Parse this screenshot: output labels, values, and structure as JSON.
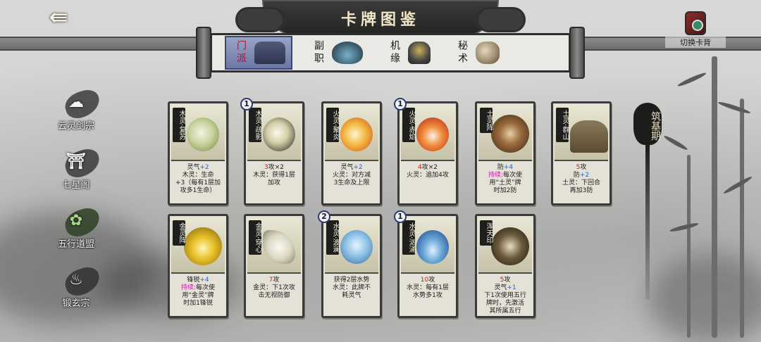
{
  "header": {
    "title": "卡牌图鉴",
    "back_icon": "back-arrow-icon",
    "switch_back_label": "切换卡背"
  },
  "tabs": [
    {
      "label": "门派",
      "icon": "sect-gate-icon",
      "active": true
    },
    {
      "label": "副职",
      "icon": "straw-hat-icon",
      "active": false
    },
    {
      "label": "机缘",
      "icon": "helmet-icon",
      "active": false
    },
    {
      "label": "秘术",
      "icon": "gourd-icon",
      "active": false
    }
  ],
  "sects": [
    {
      "label": "云灵剑宗",
      "icon": "cloud-sword-icon"
    },
    {
      "label": "七星阁",
      "icon": "pavilion-icon"
    },
    {
      "label": "五行道盟",
      "icon": "five-elements-icon"
    },
    {
      "label": "锻玄宗",
      "icon": "forge-icon"
    }
  ],
  "realm": {
    "label": "筑基期"
  },
  "cards": [
    {
      "tag": "木灵·复苏",
      "art": "wood",
      "badge": "",
      "lines": [
        [
          {
            "t": "灵气"
          },
          {
            "t": "+2",
            "c": "blue"
          }
        ],
        [
          {
            "t": "木灵：生命"
          }
        ],
        [
          {
            "t": "+3（每有1层加"
          }
        ],
        [
          {
            "t": "攻多1生命）"
          }
        ]
      ]
    },
    {
      "tag": "木灵·疏影",
      "art": "woodshadow",
      "badge": "1",
      "lines": [
        [
          {
            "t": "3",
            "c": "red"
          },
          {
            "t": "攻×2"
          }
        ],
        [
          {
            "t": "木灵：获得1层"
          }
        ],
        [
          {
            "t": "加攻"
          }
        ]
      ]
    },
    {
      "tag": "火灵·聚炎",
      "art": "fire",
      "badge": "",
      "lines": [
        [
          {
            "t": "灵气"
          },
          {
            "t": "+2",
            "c": "blue"
          }
        ],
        [
          {
            "t": "火灵：对方减"
          }
        ],
        [
          {
            "t": "3生命及上限"
          }
        ]
      ]
    },
    {
      "tag": "火灵·赤焰",
      "art": "fire2",
      "badge": "1",
      "lines": [
        [
          {
            "t": "4",
            "c": "red"
          },
          {
            "t": "攻×2"
          }
        ],
        [
          {
            "t": "火灵：追加4攻"
          }
        ]
      ]
    },
    {
      "tag": "土灵阵",
      "art": "earth",
      "badge": "",
      "lines": [
        [
          {
            "t": "防"
          },
          {
            "t": "+4",
            "c": "blue"
          }
        ],
        [
          {
            "t": "持续:",
            "c": "mag"
          },
          {
            "t": "每次使"
          }
        ],
        [
          {
            "t": "用“土灵”牌"
          }
        ],
        [
          {
            "t": "时加2防"
          }
        ]
      ]
    },
    {
      "tag": "土灵·群山",
      "art": "mountain",
      "badge": "",
      "lines": [
        [
          {
            "t": "5",
            "c": "red"
          },
          {
            "t": "攻"
          }
        ],
        [
          {
            "t": "防"
          },
          {
            "t": "+2",
            "c": "blue"
          }
        ],
        [
          {
            "t": "土灵：下回合"
          }
        ],
        [
          {
            "t": "再加3防"
          }
        ]
      ]
    },
    {
      "tag": "金灵阵",
      "art": "gold",
      "badge": "",
      "lines": [
        [
          {
            "t": "锋锐"
          },
          {
            "t": "+4",
            "c": "blue"
          }
        ],
        [
          {
            "t": "持续:",
            "c": "mag"
          },
          {
            "t": "每次使"
          }
        ],
        [
          {
            "t": "用“金灵”牌"
          }
        ],
        [
          {
            "t": "时加1锋锐"
          }
        ]
      ]
    },
    {
      "tag": "金灵·穿心",
      "art": "metal",
      "badge": "",
      "lines": [
        [
          {
            "t": "7",
            "c": "red"
          },
          {
            "t": "攻"
          }
        ],
        [
          {
            "t": "金灵：下1次攻"
          }
        ],
        [
          {
            "t": "击无视防御"
          }
        ]
      ]
    },
    {
      "tag": "水灵·波澜",
      "art": "water",
      "badge": "2",
      "lines": [
        [
          {
            "t": "获得2层水势"
          }
        ],
        [
          {
            "t": "水灵：此牌不"
          }
        ],
        [
          {
            "t": "耗灵气"
          }
        ]
      ]
    },
    {
      "tag": "水灵·汹涌",
      "art": "wave",
      "badge": "1",
      "lines": [
        [
          {
            "t": "10",
            "c": "red"
          },
          {
            "t": "攻"
          }
        ],
        [
          {
            "t": "水灵：每有1层"
          }
        ],
        [
          {
            "t": "水势多1攻"
          }
        ]
      ]
    },
    {
      "tag": "浑天印",
      "art": "seal",
      "badge": "",
      "lines": [
        [
          {
            "t": "5",
            "c": "red"
          },
          {
            "t": "攻"
          }
        ],
        [
          {
            "t": "灵气"
          },
          {
            "t": "+1",
            "c": "blue"
          }
        ],
        [
          {
            "t": "下1次使用五行"
          }
        ],
        [
          {
            "t": "牌时，先激活"
          }
        ],
        [
          {
            "t": "其所属五行"
          }
        ]
      ]
    }
  ],
  "colors": {
    "attack": "#b8261c",
    "buff": "#2a64c4",
    "sustain": "#c21cae",
    "active_tab": "#6a77a6"
  }
}
